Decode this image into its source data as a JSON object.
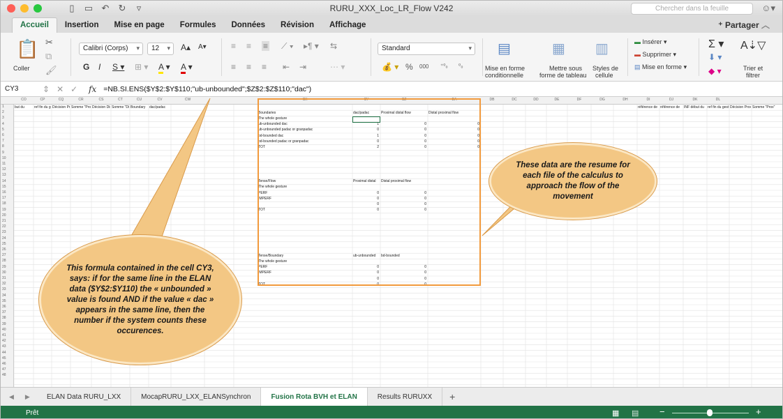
{
  "window": {
    "title": "RURU_XXX_Loc_LR_Flow V242",
    "search_placeholder": "Chercher dans la feuille"
  },
  "tabs": [
    "Accueil",
    "Insertion",
    "Mise en page",
    "Formules",
    "Données",
    "Révision",
    "Affichage"
  ],
  "share_label": "Partager",
  "ribbon": {
    "paste_label": "Coller",
    "font_name": "Calibri (Corps)",
    "font_size": "12",
    "number_format": "Standard",
    "cond_format_label_1": "Mise en forme",
    "cond_format_label_2": "conditionnelle",
    "table_format_label_1": "Mettre sous",
    "table_format_label_2": "forme de tableau",
    "cell_styles_label_1": "Styles de",
    "cell_styles_label_2": "cellule",
    "insert_label": "Insérer",
    "delete_label": "Supprimer",
    "format_label": "Mise en forme",
    "sort_label_1": "Trier et",
    "sort_label_2": "filtrer"
  },
  "formula_bar": {
    "cell_ref": "CY3",
    "fx": "fx",
    "formula": "=NB.SI.ENS($Y$2:$Y$110;\"ub-unbounded\";$Z$2:$Z$110;\"dac\")"
  },
  "columns": {
    "left": [
      "CO",
      "CP",
      "CQ",
      "CR",
      "CS",
      "CT",
      "CU",
      "CV",
      "CW"
    ],
    "mid": [
      "CX",
      "CY",
      "CZ",
      "DA"
    ],
    "right": [
      "DB",
      "DC",
      "DD",
      "DE",
      "DF",
      "DG",
      "DH",
      "DI",
      "DJ",
      "DK",
      "DL"
    ]
  },
  "row1_left": [
    "but du",
    "ref fin du geste",
    "Décision Prox",
    "Somme \"Prox\"",
    "Décision Dist",
    "Somme \"Dist\"",
    "Boundary",
    "dac/padac"
  ],
  "row1_right": [
    "référence de",
    "référence de",
    "INF début du",
    "ref fin du geste",
    "Décision Prox",
    "Somme \"Prox\""
  ],
  "table1": {
    "headers": [
      "Boundaries",
      "dac/padac",
      "Proximal distal flow",
      "Distal proximal flow"
    ],
    "rows": [
      [
        "The whole gesture",
        "",
        "",
        ""
      ],
      [
        "ub-unbounded dac",
        "1",
        "0",
        "0"
      ],
      [
        "ub-unbounded padac or granpadac",
        "0",
        "0",
        "0"
      ],
      [
        "bd-bounded dac",
        "1",
        "0",
        "0"
      ],
      [
        "bd-bounded padac or granpadac",
        "0",
        "0",
        "0"
      ],
      [
        "TOT",
        "2",
        "0",
        "0"
      ]
    ]
  },
  "table2": {
    "headers": [
      "Tense/Flow",
      "Proximal distal",
      "Distal proximal flow"
    ],
    "rows": [
      [
        "The whole gesture",
        "",
        ""
      ],
      [
        "PERF",
        "0",
        "0"
      ],
      [
        "IMPERF",
        "0",
        "0"
      ],
      [
        "",
        "0",
        "0"
      ],
      [
        "TOT",
        "0",
        "0"
      ]
    ]
  },
  "table3": {
    "headers": [
      "Tense/Boundary",
      "ub-unbounded",
      "bd-bounded"
    ],
    "rows": [
      [
        "The whole gesture",
        "",
        ""
      ],
      [
        "PERF",
        "0",
        "0"
      ],
      [
        "IMPERF",
        "0",
        "0"
      ],
      [
        "",
        "0",
        "0"
      ],
      [
        "TOT",
        "0",
        "0"
      ]
    ]
  },
  "callouts": {
    "left": "This formula contained in the cell CY3, says: if for the same line in the ELAN data ($Y$2:$Y110) the « unbounded » value is found AND if the value « dac » appears in the same line, then the number if the system counts these occurences.",
    "right": "These data are the resume for each file of the calculus to approach the flow of the movement"
  },
  "sheet_tabs": [
    "ELAN Data RURU_LXX",
    "MocapRURU_LXX_ELANSynchron",
    "Fusion Rota BVH et ELAN",
    "Results RURUXX"
  ],
  "active_sheet": "Fusion Rota BVH et ELAN",
  "status": "Prêt",
  "colors": {
    "excel_green": "#217346",
    "callout": "#f3c784",
    "annotation_border": "#f29a3c"
  }
}
